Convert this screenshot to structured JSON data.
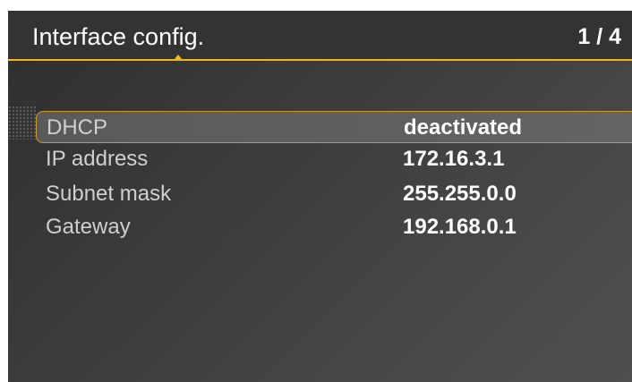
{
  "header": {
    "title": "Interface config.",
    "page_indicator": "1 / 4"
  },
  "settings": [
    {
      "label": "DHCP",
      "value": "deactivated",
      "selected": true
    },
    {
      "label": "IP address",
      "value": "172.16.3.1",
      "selected": false
    },
    {
      "label": "Subnet mask",
      "value": "255.255.0.0",
      "selected": false
    },
    {
      "label": "Gateway",
      "value": "192.168.0.1",
      "selected": false
    }
  ],
  "colors": {
    "accent": "#f2b51c",
    "background": "#3a3a3a",
    "header": "#333333"
  }
}
